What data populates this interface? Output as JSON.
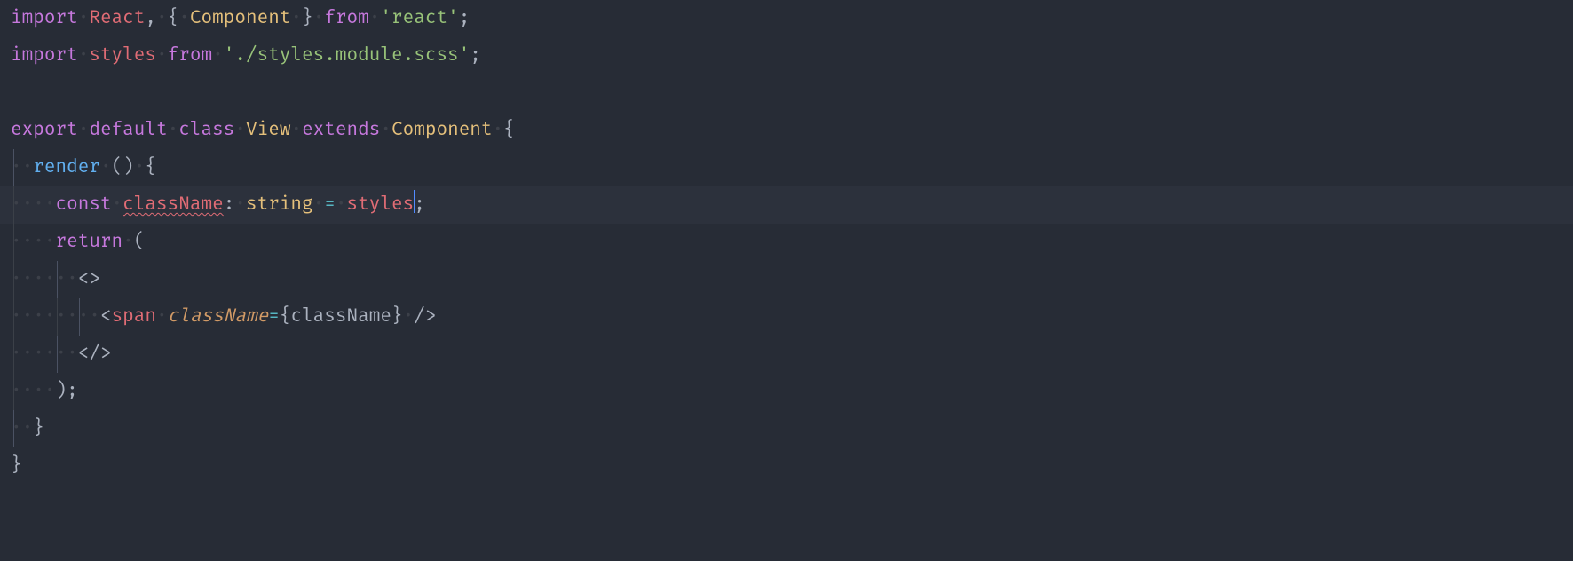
{
  "language": "tsx",
  "theme": "one-dark",
  "cursor": {
    "line_index": 5,
    "after_token": "styles"
  },
  "active_line_index": 5,
  "error_markers": [
    {
      "line_index": 5,
      "token_text": "className",
      "severity": "error"
    }
  ],
  "indent_size": 2,
  "code": {
    "lines": [
      {
        "indent": 0,
        "guides": [],
        "tokens": [
          {
            "c": "kw",
            "t": "import"
          },
          {
            "c": "ws",
            "t": " "
          },
          {
            "c": "ident",
            "t": "React"
          },
          {
            "c": "punct",
            "t": ","
          },
          {
            "c": "ws",
            "t": " "
          },
          {
            "c": "brace",
            "t": "{"
          },
          {
            "c": "ws",
            "t": " "
          },
          {
            "c": "cls",
            "t": "Component"
          },
          {
            "c": "ws",
            "t": " "
          },
          {
            "c": "brace",
            "t": "}"
          },
          {
            "c": "ws",
            "t": " "
          },
          {
            "c": "from",
            "t": "from"
          },
          {
            "c": "ws",
            "t": " "
          },
          {
            "c": "str",
            "t": "'react'"
          },
          {
            "c": "punct",
            "t": ";"
          }
        ]
      },
      {
        "indent": 0,
        "guides": [],
        "tokens": [
          {
            "c": "kw",
            "t": "import"
          },
          {
            "c": "ws",
            "t": " "
          },
          {
            "c": "ident",
            "t": "styles"
          },
          {
            "c": "ws",
            "t": " "
          },
          {
            "c": "from",
            "t": "from"
          },
          {
            "c": "ws",
            "t": " "
          },
          {
            "c": "str",
            "t": "'./styles.module.scss'"
          },
          {
            "c": "punct",
            "t": ";"
          }
        ]
      },
      {
        "indent": 0,
        "guides": [],
        "tokens": []
      },
      {
        "indent": 0,
        "guides": [],
        "tokens": [
          {
            "c": "kw",
            "t": "export"
          },
          {
            "c": "ws",
            "t": " "
          },
          {
            "c": "kw",
            "t": "default"
          },
          {
            "c": "ws",
            "t": " "
          },
          {
            "c": "kw",
            "t": "class"
          },
          {
            "c": "ws",
            "t": " "
          },
          {
            "c": "cls",
            "t": "View"
          },
          {
            "c": "ws",
            "t": " "
          },
          {
            "c": "kw",
            "t": "extends"
          },
          {
            "c": "ws",
            "t": " "
          },
          {
            "c": "cls",
            "t": "Component"
          },
          {
            "c": "ws",
            "t": " "
          },
          {
            "c": "brace",
            "t": "{"
          }
        ]
      },
      {
        "indent": 1,
        "guides": [
          0
        ],
        "tokens": [
          {
            "c": "func",
            "t": "render"
          },
          {
            "c": "ws",
            "t": " "
          },
          {
            "c": "brace",
            "t": "()"
          },
          {
            "c": "ws",
            "t": " "
          },
          {
            "c": "brace",
            "t": "{"
          }
        ]
      },
      {
        "indent": 2,
        "guides": [
          0,
          1
        ],
        "tokens": [
          {
            "c": "kw",
            "t": "const"
          },
          {
            "c": "ws",
            "t": " "
          },
          {
            "c": "ident err",
            "t": "className"
          },
          {
            "c": "punct",
            "t": ":"
          },
          {
            "c": "ws",
            "t": " "
          },
          {
            "c": "type",
            "t": "string"
          },
          {
            "c": "ws",
            "t": " "
          },
          {
            "c": "eq",
            "t": "="
          },
          {
            "c": "ws",
            "t": " "
          },
          {
            "c": "ident",
            "t": "styles"
          },
          {
            "c": "caret",
            "t": ""
          },
          {
            "c": "punct",
            "t": ";"
          }
        ]
      },
      {
        "indent": 2,
        "guides": [
          0,
          1
        ],
        "tokens": [
          {
            "c": "kw",
            "t": "return"
          },
          {
            "c": "ws",
            "t": " "
          },
          {
            "c": "brace",
            "t": "("
          }
        ]
      },
      {
        "indent": 3,
        "guides": [
          0,
          1,
          2
        ],
        "tokens": [
          {
            "c": "tagbr",
            "t": "<>"
          }
        ]
      },
      {
        "indent": 4,
        "guides": [
          0,
          1,
          2,
          3
        ],
        "tokens": [
          {
            "c": "tagbr",
            "t": "<"
          },
          {
            "c": "tag",
            "t": "span"
          },
          {
            "c": "ws",
            "t": " "
          },
          {
            "c": "attr",
            "t": "className"
          },
          {
            "c": "eq",
            "t": "="
          },
          {
            "c": "brace",
            "t": "{"
          },
          {
            "c": "default",
            "t": "className"
          },
          {
            "c": "brace",
            "t": "}"
          },
          {
            "c": "ws",
            "t": " "
          },
          {
            "c": "tagbr",
            "t": "/>"
          }
        ]
      },
      {
        "indent": 3,
        "guides": [
          0,
          1,
          2
        ],
        "tokens": [
          {
            "c": "tagbr",
            "t": "</>"
          }
        ]
      },
      {
        "indent": 2,
        "guides": [
          0,
          1
        ],
        "tokens": [
          {
            "c": "brace",
            "t": ")"
          },
          {
            "c": "punct",
            "t": ";"
          }
        ]
      },
      {
        "indent": 1,
        "guides": [
          0
        ],
        "tokens": [
          {
            "c": "brace",
            "t": "}"
          }
        ]
      },
      {
        "indent": 0,
        "guides": [],
        "tokens": [
          {
            "c": "brace",
            "t": "}"
          }
        ]
      }
    ]
  }
}
